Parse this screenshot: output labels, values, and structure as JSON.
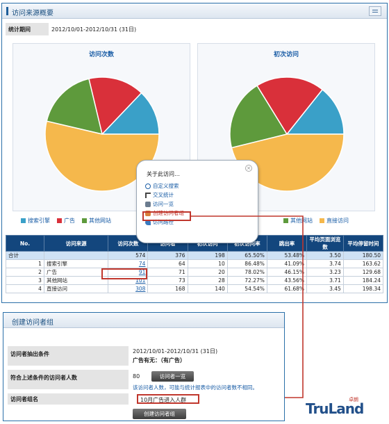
{
  "panel1": {
    "title": "访问来源概要"
  },
  "period": {
    "label": "统计期间",
    "value": "2012/10/01-2012/10/31 (31日)"
  },
  "legend": [
    "搜索引擎",
    "广告",
    "其他网站",
    "直接访问"
  ],
  "colors": {
    "search": "#3aa0c8",
    "ad": "#d9303a",
    "other": "#5e9a3c",
    "direct": "#f5b84c"
  },
  "chart_data": [
    {
      "type": "pie",
      "title": "访问次数",
      "categories": [
        "搜索引擎",
        "广告",
        "其他网站",
        "直接访问"
      ],
      "values": [
        74,
        91,
        101,
        308
      ]
    },
    {
      "type": "pie",
      "title": "初次访问",
      "categories": [
        "搜索引擎",
        "广告",
        "其他网站",
        "直接访问"
      ],
      "values": [
        52,
        71,
        73,
        168
      ]
    }
  ],
  "popup": {
    "title": "关于此访问…",
    "items": [
      "自定义搜索",
      "交叉统计",
      "访问一览",
      "创建访问者组",
      "访问路径"
    ]
  },
  "table": {
    "headers": [
      "No.",
      "访问来源",
      "访问次数",
      "访问者",
      "初次访问",
      "初次访问率",
      "跳出率",
      "平均页面浏览数",
      "平均停留时间"
    ],
    "total": [
      "合计",
      "",
      "574",
      "376",
      "198",
      "65.50%",
      "53.48%",
      "3.50",
      "180.50"
    ],
    "rows": [
      [
        "1",
        "搜索引擎",
        "74",
        "64",
        "10",
        "86.48%",
        "41.09%",
        "3.74",
        "163.62"
      ],
      [
        "2",
        "广告",
        "91",
        "71",
        "20",
        "78.02%",
        "46.15%",
        "3.23",
        "129.68"
      ],
      [
        "3",
        "其他网站",
        "101",
        "73",
        "28",
        "72.27%",
        "43.56%",
        "3.71",
        "184.24"
      ],
      [
        "4",
        "直接访问",
        "308",
        "168",
        "140",
        "54.54%",
        "61.68%",
        "3.45",
        "198.34"
      ]
    ]
  },
  "panel2": {
    "title": "创建访问者组",
    "cond_label": "访问者抽出条件",
    "cond_value": "2012/10/01-2012/10/31 (31日)",
    "cond_sub": "广告有无：（有广告）",
    "count_label": "符合上述条件的访问者人数",
    "count_value": "80",
    "list_button": "访问者一览",
    "note": "该访问者人数，可能与统计报表中的访问者数不相同。",
    "name_label": "访问者组名",
    "name_value": "10月广告进入人群",
    "create_button": "创建访问者组"
  },
  "logo": {
    "text": "TruLand",
    "cn": "卓朗"
  }
}
